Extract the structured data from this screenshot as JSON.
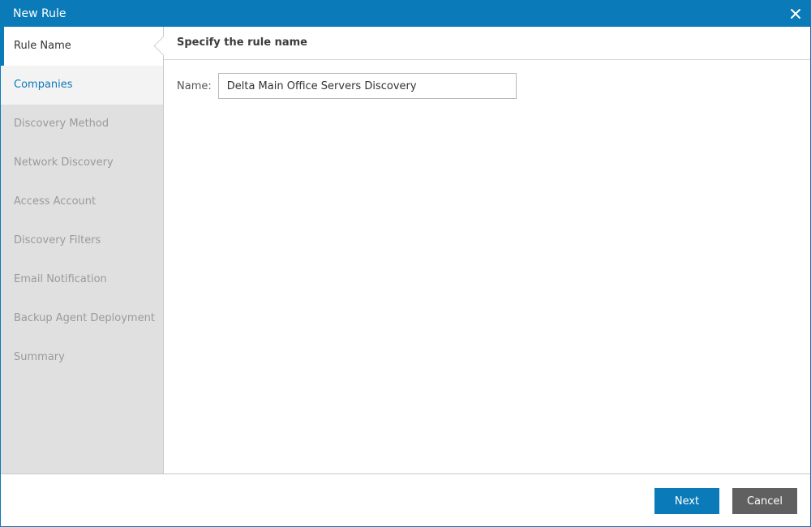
{
  "window": {
    "title": "New Rule",
    "close_icon": "close-icon"
  },
  "sidebar": {
    "steps": [
      {
        "label": "Rule Name",
        "state": "active"
      },
      {
        "label": "Companies",
        "state": "next"
      },
      {
        "label": "Discovery Method",
        "state": "disabled"
      },
      {
        "label": "Network Discovery",
        "state": "disabled"
      },
      {
        "label": "Access Account",
        "state": "disabled"
      },
      {
        "label": "Discovery Filters",
        "state": "disabled"
      },
      {
        "label": "Email Notification",
        "state": "disabled"
      },
      {
        "label": "Backup Agent Deployment",
        "state": "disabled"
      },
      {
        "label": "Summary",
        "state": "disabled"
      }
    ]
  },
  "content": {
    "heading": "Specify the rule name",
    "name_label": "Name:",
    "name_value": "Delta Main Office Servers Discovery"
  },
  "footer": {
    "next_label": "Next",
    "cancel_label": "Cancel"
  },
  "colors": {
    "accent": "#0a7ab8",
    "cancel": "#606060",
    "sidebar_bg": "#e0e0e0"
  }
}
